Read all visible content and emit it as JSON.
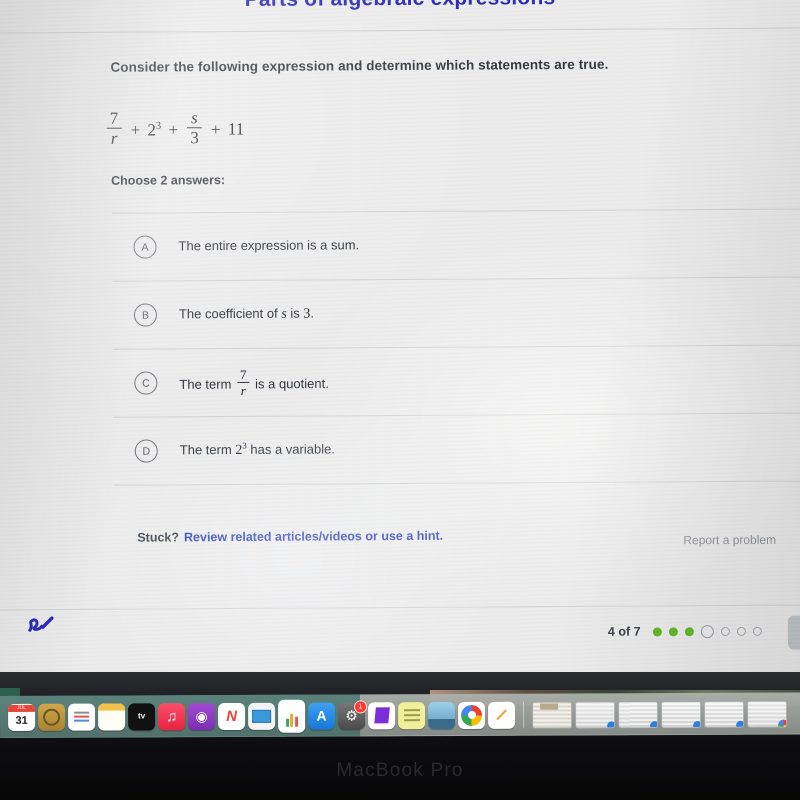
{
  "exercise": {
    "title": "Parts of algebraic expressions",
    "prompt": "Consider the following expression and determine which statements are true.",
    "expression": {
      "frac1_num": "7",
      "frac1_den": "r",
      "op1": "+",
      "power_base": "2",
      "power_exp": "3",
      "op2": "+",
      "frac2_num": "s",
      "frac2_den": "3",
      "op3": "+",
      "constant": "11"
    },
    "choose_label": "Choose 2 answers:",
    "choices": [
      {
        "letter": "A",
        "text": "The entire expression is a sum."
      },
      {
        "letter": "B",
        "text_before": "The coefficient of ",
        "var": "s",
        "text_mid": " is ",
        "value": "3",
        "text_after": "."
      },
      {
        "letter": "C",
        "text_before": "The term ",
        "num": "7",
        "den": "r",
        "text_after": " is a quotient."
      },
      {
        "letter": "D",
        "text_before": "The term ",
        "base": "2",
        "exp": "3",
        "text_after": " has a variable."
      }
    ],
    "footer": {
      "stuck_label": "Stuck?",
      "hint_link": "Review related articles/videos or use a hint.",
      "report_label": "Report a problem"
    },
    "pager": {
      "label": "4 of 7",
      "completed": 3,
      "current": 1,
      "remaining": 3
    }
  },
  "colors": {
    "title": "#2b2bb5",
    "link": "#2a3fb8",
    "progress_done": "#5fb926",
    "muted": "#8d9197"
  },
  "device": {
    "brand": "MacBook Pro",
    "dock": {
      "icons": [
        {
          "name": "calendar-icon",
          "top": "JUL",
          "label": "31"
        },
        {
          "name": "contacts-icon",
          "label": ""
        },
        {
          "name": "reminders-icon",
          "label": ""
        },
        {
          "name": "notes-icon",
          "label": ""
        },
        {
          "name": "apple-tv-icon",
          "label": "tv"
        },
        {
          "name": "music-icon",
          "label": "♫"
        },
        {
          "name": "podcasts-icon",
          "label": "◉"
        },
        {
          "name": "news-icon",
          "label": "N"
        },
        {
          "name": "keynote-icon",
          "label": ""
        },
        {
          "name": "numbers-icon",
          "label": ""
        },
        {
          "name": "app-store-icon",
          "label": "A"
        },
        {
          "name": "system-settings-icon",
          "label": "⚙",
          "badge": "1"
        },
        {
          "name": "purple-app-icon",
          "label": ""
        },
        {
          "name": "stickies-icon",
          "label": ""
        },
        {
          "name": "preview-icon",
          "label": ""
        },
        {
          "name": "chrome-icon",
          "label": ""
        },
        {
          "name": "pages-icon",
          "label": ""
        }
      ],
      "minimized_windows": 6
    }
  }
}
